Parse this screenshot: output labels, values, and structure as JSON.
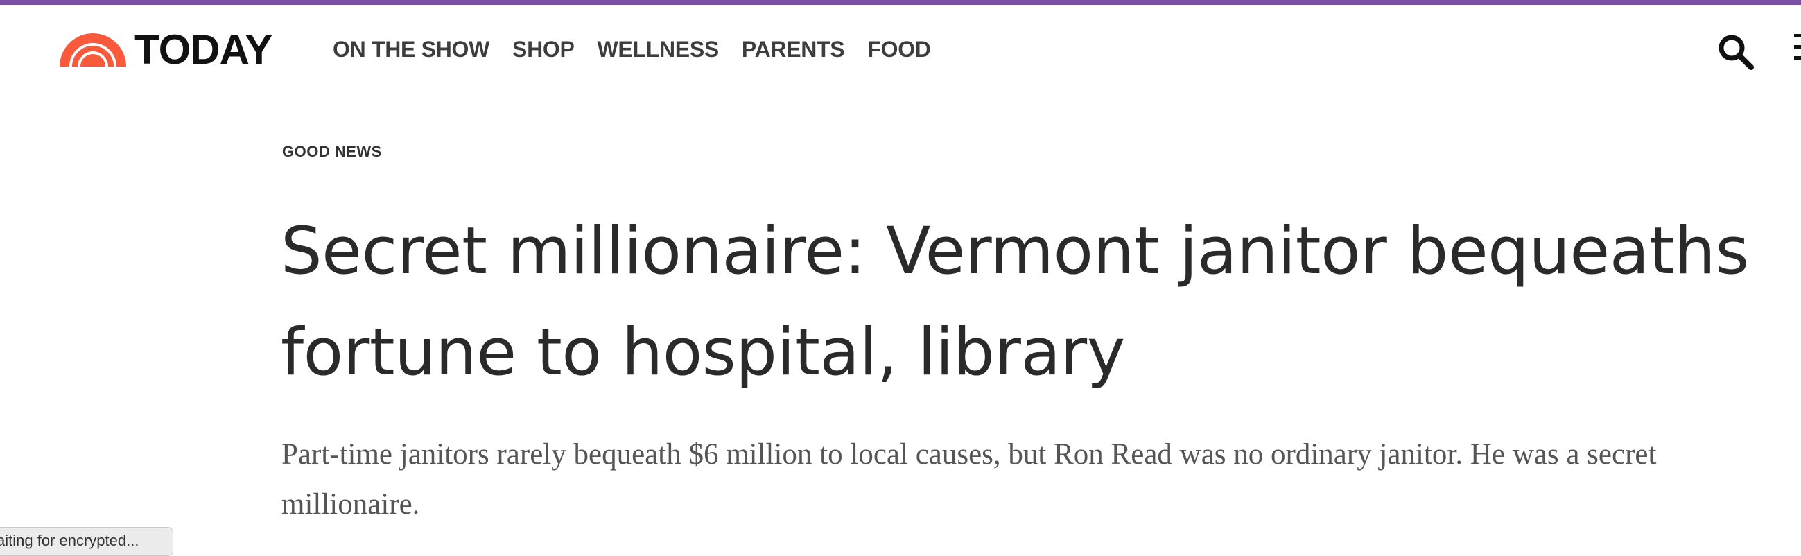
{
  "brand": {
    "name": "TODAY",
    "accent": "#fa5a3c",
    "topbar_color": "#7b4fa3"
  },
  "nav": {
    "items": [
      {
        "label": "ON THE SHOW"
      },
      {
        "label": "SHOP"
      },
      {
        "label": "WELLNESS"
      },
      {
        "label": "PARENTS"
      },
      {
        "label": "FOOD"
      }
    ],
    "search_icon": "search-icon",
    "menu_icon": "hamburger-menu-icon"
  },
  "article": {
    "eyebrow": "GOOD NEWS",
    "headline": "Secret millionaire: Vermont janitor bequeaths fortune to hospital, library",
    "dek": "Part-time janitors rarely bequeath $6 million to local causes, but Ron Read was no ordinary janitor. He was a secret millionaire."
  },
  "browser": {
    "status_text": "aiting for encrypted..."
  }
}
